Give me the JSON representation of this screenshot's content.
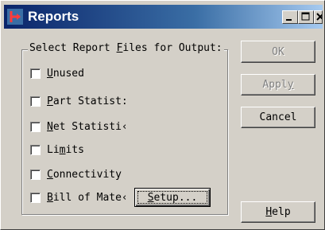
{
  "window": {
    "title": "Reports",
    "controls": {
      "minimize": "minimize",
      "maximize": "maximize",
      "close": "close"
    }
  },
  "group": {
    "label_pre": "Select Report ",
    "label_accel": "F",
    "label_post": "iles for Output:"
  },
  "checkboxes": [
    {
      "pre": "",
      "accel": "U",
      "post": "nused",
      "checked": false
    },
    {
      "pre": "",
      "accel": "P",
      "post": "art Statist:",
      "checked": false
    },
    {
      "pre": "",
      "accel": "N",
      "post": "et Statisti‹",
      "checked": false
    },
    {
      "pre": "Li",
      "accel": "m",
      "post": "its",
      "checked": false
    },
    {
      "pre": "",
      "accel": "C",
      "post": "onnectivity",
      "checked": false
    },
    {
      "pre": "",
      "accel": "B",
      "post": "ill of Mate‹",
      "checked": false
    }
  ],
  "buttons": {
    "ok": "OK",
    "apply_pre": "Appl",
    "apply_accel": "y",
    "cancel": "Cancel",
    "setup_accel": "S",
    "setup_post": "etup...",
    "help_accel": "H",
    "help_post": "elp"
  }
}
